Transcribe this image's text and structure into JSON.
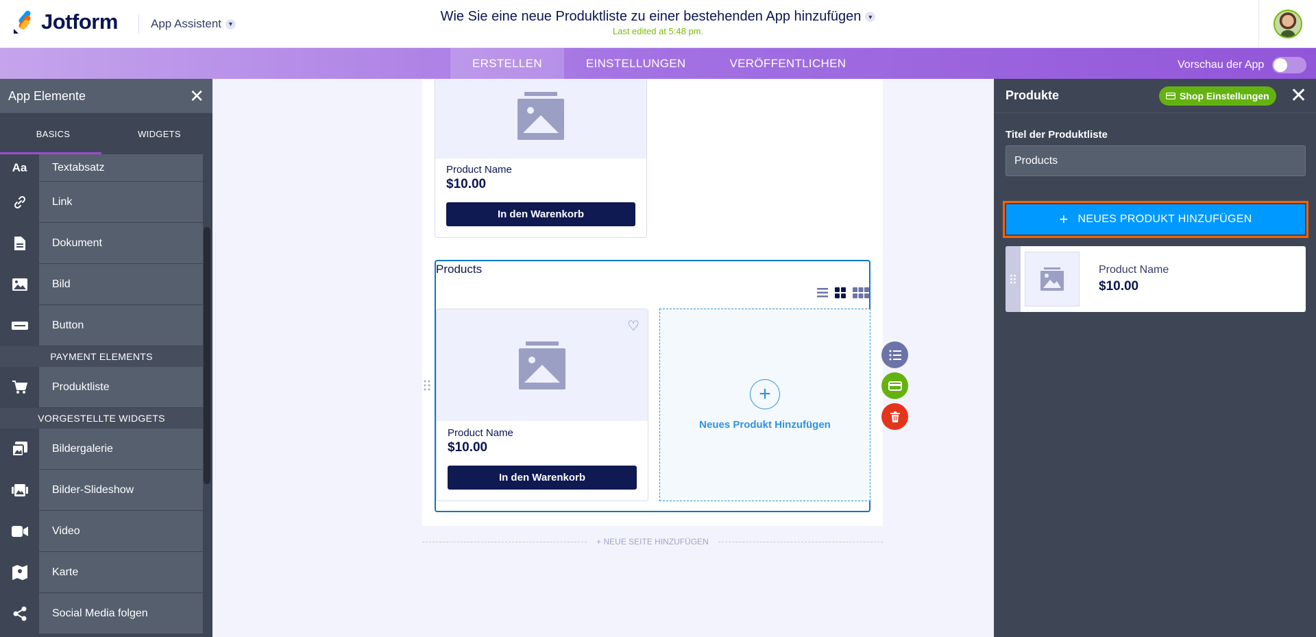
{
  "header": {
    "logo_text": "Jotform",
    "app_assistant": "App Assistent",
    "title": "Wie Sie eine neue Produktliste zu einer bestehenden App hinzufügen",
    "last_edited": "Last edited at 5:48 pm."
  },
  "nav": {
    "tabs": [
      "ERSTELLEN",
      "EINSTELLUNGEN",
      "VERÖFFENTLICHEN"
    ],
    "active_tab": "ERSTELLEN",
    "preview_label": "Vorschau der App"
  },
  "left_panel": {
    "title": "App Elemente",
    "tabs": [
      "BASICS",
      "WIDGETS"
    ],
    "items_top": [
      {
        "label": "Textabsatz",
        "icon": "text-paragraph-icon"
      },
      {
        "label": "Link",
        "icon": "link-icon"
      },
      {
        "label": "Dokument",
        "icon": "document-icon"
      },
      {
        "label": "Bild",
        "icon": "image-icon"
      },
      {
        "label": "Button",
        "icon": "button-icon"
      }
    ],
    "section_payment": "PAYMENT ELEMENTS",
    "items_payment": [
      {
        "label": "Produktliste",
        "icon": "shopping-cart-icon"
      }
    ],
    "section_widgets": "VORGESTELLTE WIDGETS",
    "items_widgets": [
      {
        "label": "Bildergalerie",
        "icon": "image-gallery-icon"
      },
      {
        "label": "Bilder-Slideshow",
        "icon": "slideshow-icon"
      },
      {
        "label": "Video",
        "icon": "video-icon"
      },
      {
        "label": "Karte",
        "icon": "map-icon"
      },
      {
        "label": "Social Media folgen",
        "icon": "share-icon"
      }
    ]
  },
  "canvas": {
    "top_card": {
      "name": "Product Name",
      "price": "$10.00",
      "button": "In den Warenkorb"
    },
    "product_list": {
      "title": "Products",
      "card": {
        "name": "Product Name",
        "price": "$10.00",
        "button": "In den Warenkorb"
      },
      "add_label": "Neues Produkt Hinzufügen"
    },
    "new_page": "+ NEUE SEITE HINZUFÜGEN"
  },
  "right_panel": {
    "title": "Produkte",
    "shop_button": "Shop Einstellungen",
    "field_label": "Titel der Produktliste",
    "field_value": "Products",
    "add_button": "NEUES PRODUKT HINZUFÜGEN",
    "product": {
      "name": "Product Name",
      "price": "$10.00"
    }
  },
  "colors": {
    "brand_purple": "#a371e3",
    "panel_dark": "#3e4555",
    "accent_blue": "#0099ff",
    "highlight_orange": "#ff6100",
    "green": "#64b210",
    "delete_red": "#e3341c"
  }
}
